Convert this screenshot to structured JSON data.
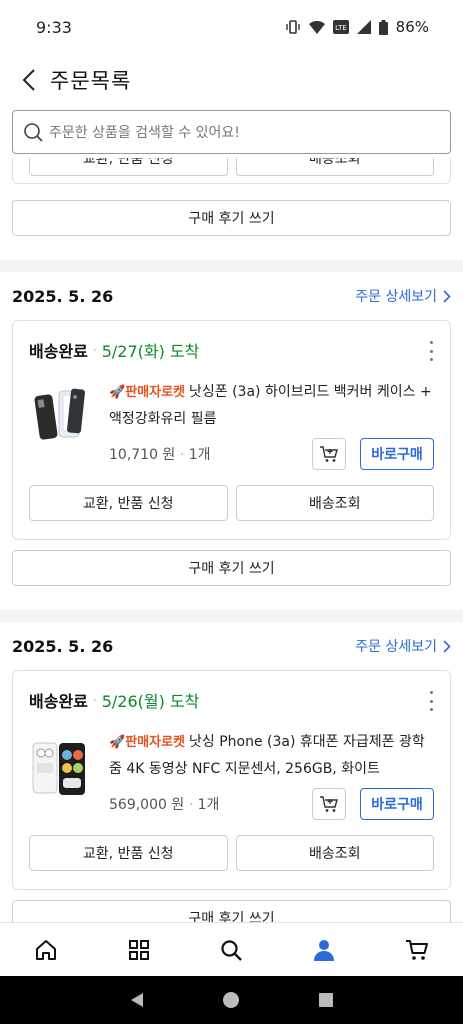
{
  "status_bar": {
    "time": "9:33",
    "battery": "86%"
  },
  "header": {
    "title": "주문목록"
  },
  "search": {
    "placeholder": "주문한 상품을 검색할 수 있어요!"
  },
  "labels": {
    "exchange_return": "교환, 반품 신청",
    "tracking": "배송조회",
    "review": "구매 후기 쓰기",
    "order_detail": "주문 상세보기",
    "buy_now": "바로구매",
    "seller_rocket": "판매자로켓",
    "delivered": "배송완료"
  },
  "orders": [
    {
      "date": "2025. 5. 26",
      "arrival": "5/27(화) 도착",
      "product_name": "낫싱폰 (3a) 하이브리드 백커버 케이스 + 액정강화유리 필름",
      "price": "10,710 원",
      "quantity": "1개"
    },
    {
      "date": "2025. 5. 26",
      "arrival": "5/26(월) 도착",
      "product_name": "낫싱 Phone (3a) 휴대폰 자급제폰 광학줌 4K 동영상 NFC 지문센서, 256GB, 화이트",
      "price": "569,000 원",
      "quantity": "1개"
    }
  ],
  "bottom_nav": [
    "home-icon",
    "category-icon",
    "search-icon",
    "my-page-icon",
    "cart-icon"
  ],
  "colors": {
    "accent": "#2a6bd9",
    "delivered_green": "#0a8a2a",
    "rocket_orange": "#e8501c"
  }
}
